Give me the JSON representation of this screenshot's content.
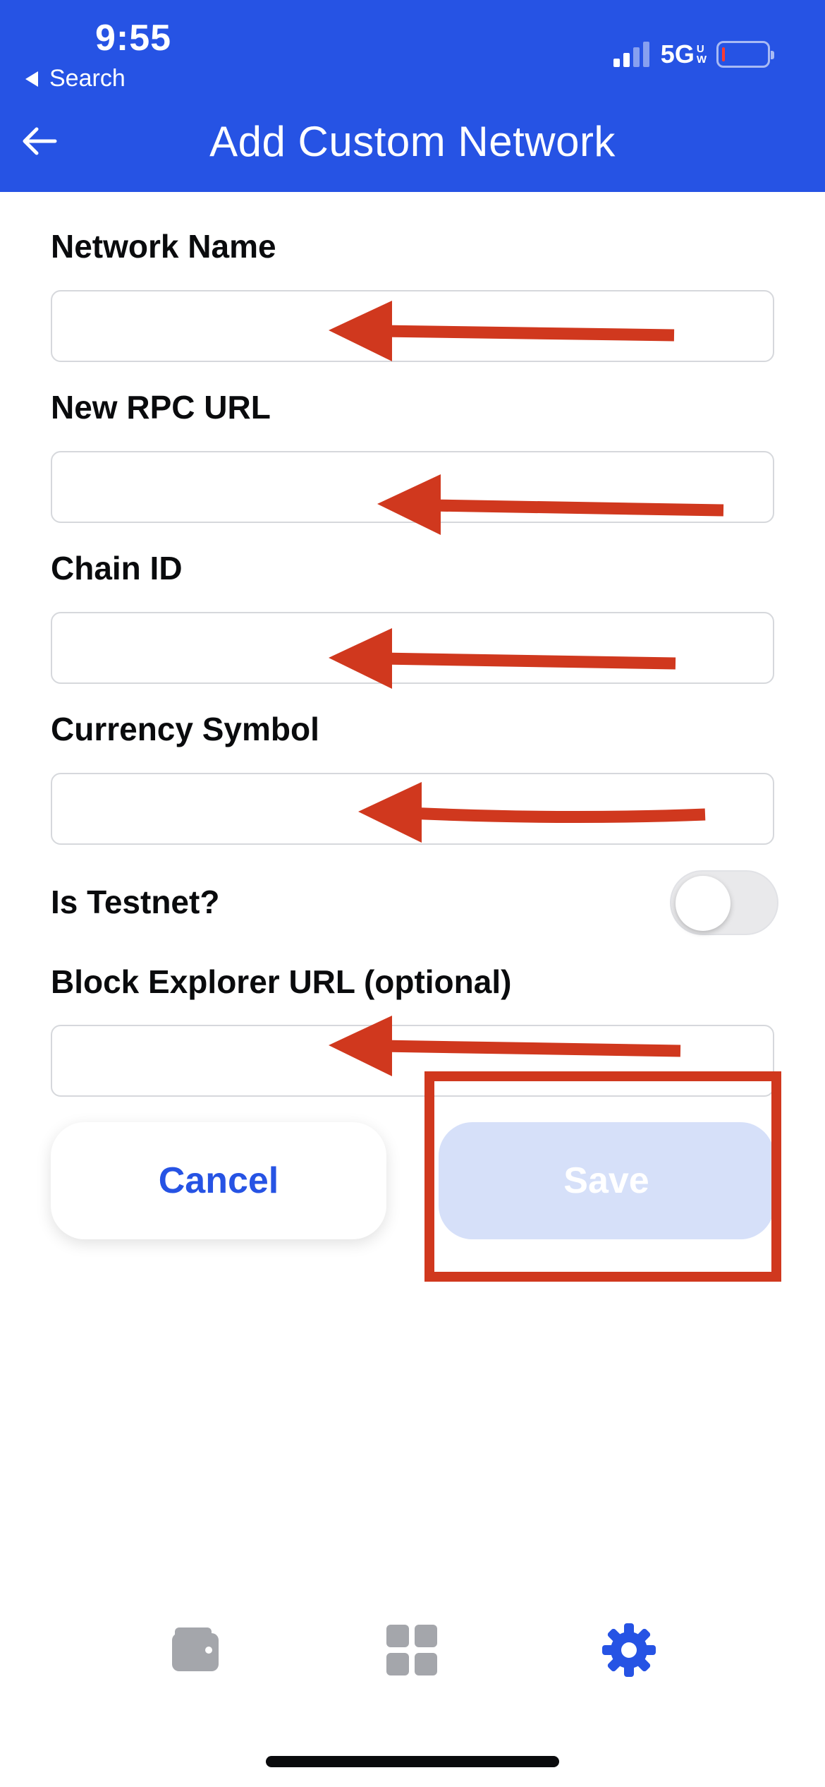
{
  "status_bar": {
    "time": "9:55",
    "back_app_label": "Search",
    "network": "5G",
    "network_sub": [
      "U",
      "W"
    ],
    "battery_level": 0.05
  },
  "header": {
    "title": "Add Custom Network",
    "back_icon": "arrow-left-icon"
  },
  "form": {
    "network_name": {
      "label": "Network Name",
      "value": ""
    },
    "rpc_url": {
      "label": "New RPC URL",
      "value": ""
    },
    "chain_id": {
      "label": "Chain ID",
      "value": ""
    },
    "currency_symbol": {
      "label": "Currency Symbol",
      "value": ""
    },
    "testnet": {
      "label": "Is Testnet?",
      "checked": false
    },
    "block_explorer_url": {
      "label": "Block Explorer URL (optional)",
      "value": ""
    }
  },
  "actions": {
    "cancel_label": "Cancel",
    "save_label": "Save",
    "save_enabled": false
  },
  "tab_bar": {
    "items": [
      {
        "icon": "wallet-icon",
        "active": false
      },
      {
        "icon": "apps-grid-icon",
        "active": false
      },
      {
        "icon": "gear-icon",
        "active": true
      }
    ]
  },
  "colors": {
    "brand_blue": "#2653e4",
    "annotation_red": "#d0381e",
    "save_disabled_bg": "#d6e0f9",
    "inactive_icon": "#a4a6ab"
  }
}
